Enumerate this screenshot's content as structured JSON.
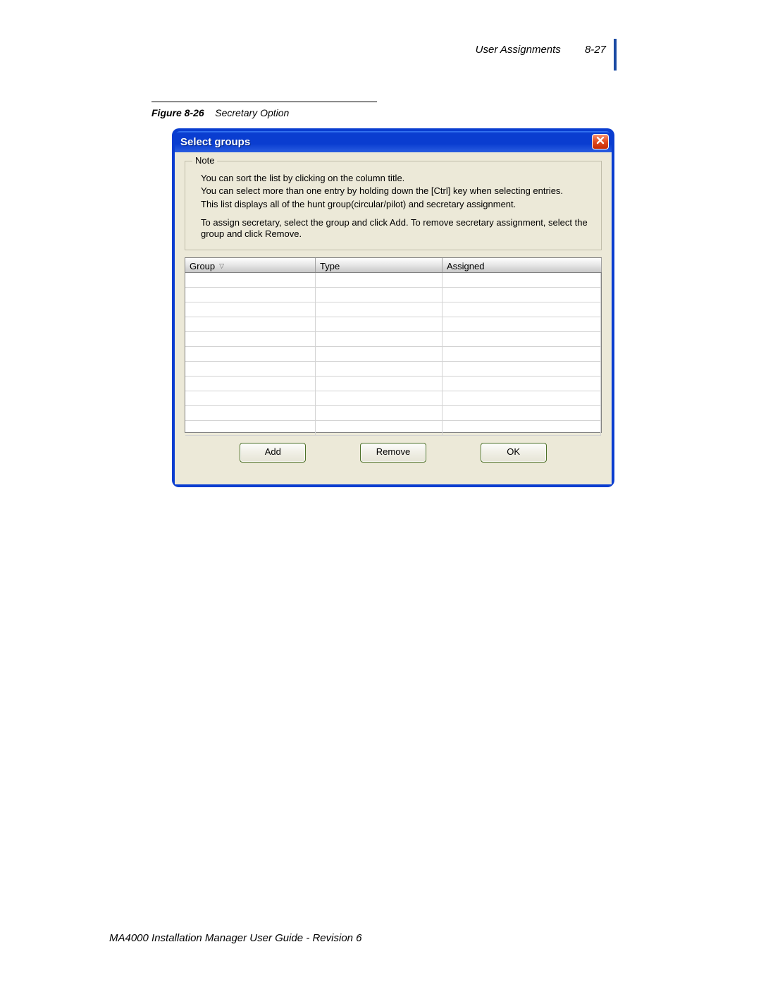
{
  "header": {
    "section_title": "User Assignments",
    "page_number": "8-27"
  },
  "figure": {
    "label": "Figure 8-26",
    "title": "Secretary Option"
  },
  "dialog": {
    "title": "Select groups",
    "note": {
      "legend": "Note",
      "line1": "You can sort the list by clicking on the column title.",
      "line2": "You can select more than one entry by holding down the [Ctrl] key when selecting entries.",
      "line3": "This list displays all of the hunt group(circular/pilot) and secretary assignment.",
      "line4": "To assign secretary, select the group and click Add. To remove secretary assignment, select the group and click Remove."
    },
    "columns": {
      "group": "Group",
      "type": "Type",
      "assigned": "Assigned"
    },
    "rows": [
      {
        "group": "",
        "type": "",
        "assigned": ""
      },
      {
        "group": "",
        "type": "",
        "assigned": ""
      },
      {
        "group": "",
        "type": "",
        "assigned": ""
      },
      {
        "group": "",
        "type": "",
        "assigned": ""
      },
      {
        "group": "",
        "type": "",
        "assigned": ""
      },
      {
        "group": "",
        "type": "",
        "assigned": ""
      },
      {
        "group": "",
        "type": "",
        "assigned": ""
      },
      {
        "group": "",
        "type": "",
        "assigned": ""
      },
      {
        "group": "",
        "type": "",
        "assigned": ""
      },
      {
        "group": "",
        "type": "",
        "assigned": ""
      },
      {
        "group": "",
        "type": "",
        "assigned": ""
      }
    ],
    "buttons": {
      "add": "Add",
      "remove": "Remove",
      "ok": "OK"
    }
  },
  "footer": {
    "text": "MA4000 Installation Manager User Guide - Revision 6"
  }
}
